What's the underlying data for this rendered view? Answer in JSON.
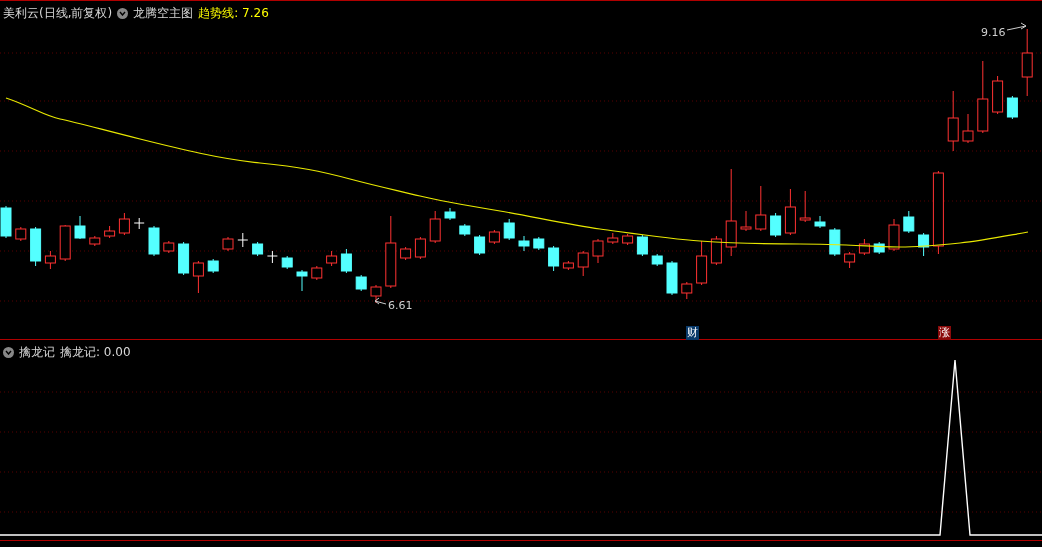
{
  "main_panel": {
    "security": "美利云(日线,前复权)",
    "indicator": "龙腾空主图",
    "line_label": "趋势线:",
    "line_value": "7.26",
    "high_label": "9.16",
    "low_label": "6.61",
    "markers": [
      {
        "text": "财",
        "kind": "finance"
      },
      {
        "text": "涨",
        "kind": "limit-up"
      }
    ]
  },
  "sub_panel": {
    "indicator": "擒龙记",
    "line_label": "擒龙记:",
    "line_value": "0.00"
  }
}
